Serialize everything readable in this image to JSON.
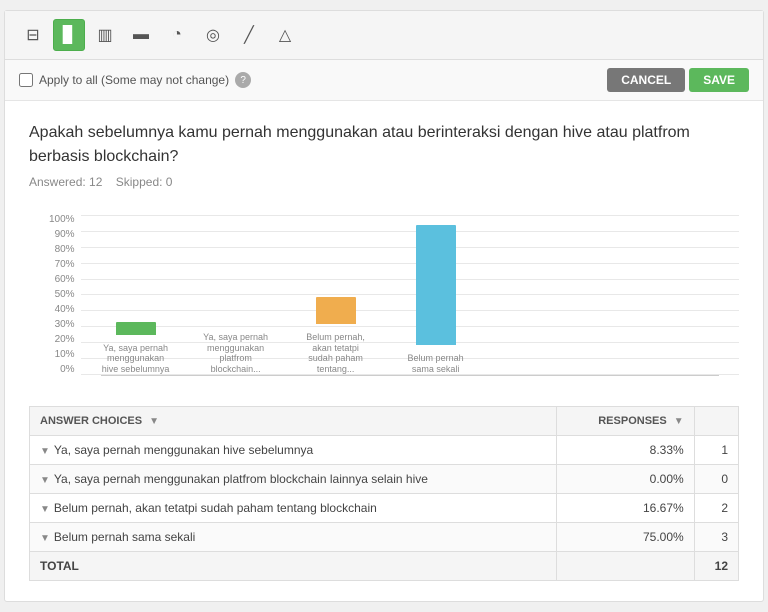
{
  "toolbar": {
    "icons": [
      {
        "name": "table-chart-icon",
        "symbol": "⊞",
        "active": false
      },
      {
        "name": "bar-chart-icon",
        "symbol": "▊",
        "active": true
      },
      {
        "name": "stacked-chart-icon",
        "symbol": "▥",
        "active": false
      },
      {
        "name": "column-chart-icon",
        "symbol": "⩛",
        "active": false
      },
      {
        "name": "pie-chart-icon",
        "symbol": "◔",
        "active": false
      },
      {
        "name": "donut-chart-icon",
        "symbol": "◎",
        "active": false
      },
      {
        "name": "line-chart-icon",
        "symbol": "⟋",
        "active": false
      },
      {
        "name": "area-chart-icon",
        "symbol": "◺",
        "active": false
      }
    ]
  },
  "options_bar": {
    "apply_all_label": "Apply to all (Some may not change)",
    "help_tooltip": "?",
    "cancel_label": "CANCEL",
    "save_label": "SAVE"
  },
  "question": {
    "title": "Apakah sebelumnya kamu pernah menggunakan atau berinteraksi dengan hive atau platfrom berbasis blockchain?",
    "answered_label": "Answered:",
    "answered_value": "12",
    "skipped_label": "Skipped:",
    "skipped_value": "0"
  },
  "chart": {
    "y_labels": [
      "0%",
      "10%",
      "20%",
      "30%",
      "40%",
      "50%",
      "60%",
      "70%",
      "80%",
      "90%",
      "100%"
    ],
    "bars": [
      {
        "label": "Ya, saya pernah menggunakan hive sebelumnya",
        "short_label": "Ya, saya pernah\nmenggunakan hive\nsebelumnya",
        "height_pct": 8.33,
        "color": "#5cb85c"
      },
      {
        "label": "Ya, saya pernah menggunakan platform blockchain lainnya selain hive",
        "short_label": "Ya, saya pernah\nmenggunakan\nplatfrom\nblockchain...",
        "height_pct": 0,
        "color": "#5cb85c"
      },
      {
        "label": "Belum pernah, akan tetatpi sudah paham tentang blockchain",
        "short_label": "Belum pernah,\nakan tetatpi\nsudah paham\ntentang...",
        "height_pct": 16.67,
        "color": "#f0ad4e"
      },
      {
        "label": "Belum pernah sama sekali",
        "short_label": "Belum pernah\nsama sekali",
        "height_pct": 75,
        "color": "#5bc0de"
      }
    ]
  },
  "table": {
    "col_answer": "ANSWER CHOICES",
    "col_responses": "RESPONSES",
    "rows": [
      {
        "label": "Ya, saya pernah menggunakan hive sebelumnya",
        "pct": "8.33%",
        "count": "1"
      },
      {
        "label": "Ya, saya pernah menggunakan platfrom blockchain lainnya selain hive",
        "pct": "0.00%",
        "count": "0"
      },
      {
        "label": "Belum pernah, akan tetatpi sudah paham tentang blockchain",
        "pct": "16.67%",
        "count": "2"
      },
      {
        "label": "Belum pernah sama sekali",
        "pct": "75.00%",
        "count": "3"
      }
    ],
    "total_label": "TOTAL",
    "total_count": "12"
  }
}
